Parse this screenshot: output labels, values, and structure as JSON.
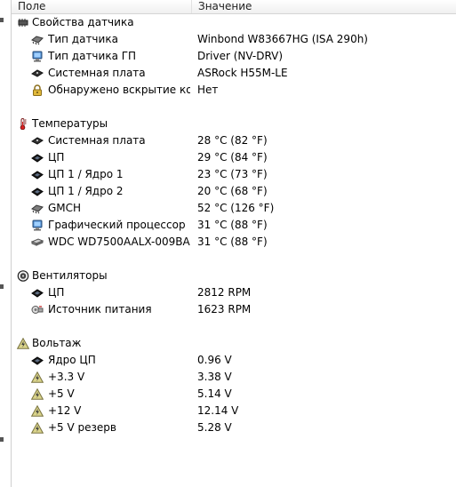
{
  "columns": {
    "field": "Поле",
    "value": "Значение"
  },
  "groups": [
    {
      "title": "Свойства датчика",
      "icon": "sensor-chip-icon",
      "items": [
        {
          "label": "Тип датчика",
          "value": "Winbond W83667HG  (ISA 290h)",
          "icon": "chip-icon"
        },
        {
          "label": "Тип датчика ГП",
          "value": "Driver  (NV-DRV)",
          "icon": "monitor-icon"
        },
        {
          "label": "Системная плата",
          "value": "ASRock H55M-LE",
          "icon": "motherboard-icon"
        },
        {
          "label": "Обнаружено вскрытие кор...",
          "value": "Нет",
          "icon": "padlock-icon"
        }
      ]
    },
    {
      "title": "Температуры",
      "icon": "thermometer-icon",
      "items": [
        {
          "label": "Системная плата",
          "value": "28 °C  (82 °F)",
          "icon": "motherboard-icon"
        },
        {
          "label": "ЦП",
          "value": "29 °C  (84 °F)",
          "icon": "cpu-icon"
        },
        {
          "label": "ЦП 1 / Ядро 1",
          "value": "23 °C  (73 °F)",
          "icon": "cpu-icon"
        },
        {
          "label": "ЦП 1 / Ядро 2",
          "value": "20 °C  (68 °F)",
          "icon": "cpu-icon"
        },
        {
          "label": "GMCH",
          "value": "52 °C  (126 °F)",
          "icon": "chip-icon"
        },
        {
          "label": "Графический процессор",
          "value": "31 °C  (88 °F)",
          "icon": "monitor-icon"
        },
        {
          "label": "WDC WD7500AALX-009BA0",
          "value": "31 °C  (88 °F)",
          "icon": "hard-drive-icon"
        }
      ]
    },
    {
      "title": "Вентиляторы",
      "icon": "fan-icon",
      "items": [
        {
          "label": "ЦП",
          "value": "2812 RPM",
          "icon": "cpu-icon"
        },
        {
          "label": "Источник питания",
          "value": "1623 RPM",
          "icon": "power-supply-icon"
        }
      ]
    },
    {
      "title": "Вольтаж",
      "icon": "voltage-icon",
      "items": [
        {
          "label": "Ядро ЦП",
          "value": "0.96 V",
          "icon": "cpu-icon"
        },
        {
          "label": "+3.3 V",
          "value": "3.38 V",
          "icon": "voltage-icon"
        },
        {
          "label": "+5 V",
          "value": "5.14 V",
          "icon": "voltage-icon"
        },
        {
          "label": "+12 V",
          "value": "12.14 V",
          "icon": "voltage-icon"
        },
        {
          "label": "+5 V резерв",
          "value": "5.28 V",
          "icon": "voltage-icon"
        }
      ]
    }
  ]
}
